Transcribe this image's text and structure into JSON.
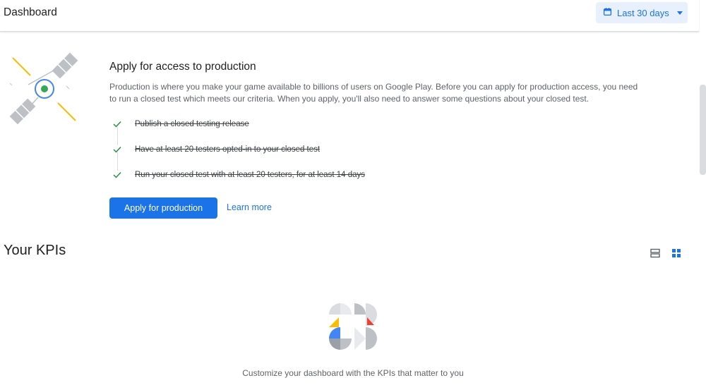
{
  "header": {
    "title": "Dashboard",
    "date_range": "Last 30 days",
    "calendar_icon": "calendar-icon",
    "dropdown_icon": "arrow-drop-down-icon"
  },
  "production": {
    "title": "Apply for access to production",
    "description": "Production is where you make your game available to billions of users on Google Play. Before you can apply for production access, you need to run a closed test which meets our criteria. When you apply, you'll also need to answer some questions about your closed test.",
    "steps": [
      {
        "label": "Publish a closed testing release",
        "done": true
      },
      {
        "label": "Have at least 20 testers opted-in to your closed test",
        "done": true
      },
      {
        "label": "Run your closed test with at least 20 testers, for at least 14 days",
        "done": true
      }
    ],
    "apply_button": "Apply for production",
    "learn_more": "Learn more"
  },
  "kpis": {
    "title": "Your KPIs",
    "empty_text": "Customize your dashboard with the KPIs that matter to you",
    "view_list_icon": "view-agenda-icon",
    "view_grid_icon": "grid-view-icon"
  },
  "colors": {
    "accent": "#1a73e8",
    "accent_light": "#e8f0fe",
    "check": "#1e8e3e",
    "text_secondary": "#5f6368"
  }
}
